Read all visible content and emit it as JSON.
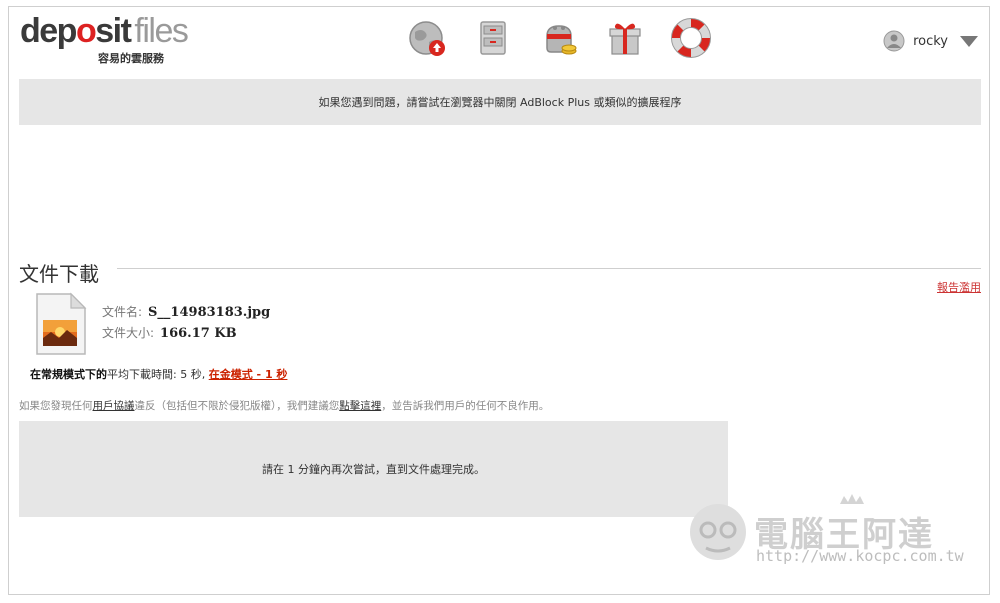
{
  "header": {
    "logo_main_a": "dep",
    "logo_main_o": "o",
    "logo_main_b": "sit",
    "logo_main_files": "files",
    "logo_tagline": "容易的雲服務",
    "nav_icons": [
      "upload-globe-icon",
      "file-cabinet-icon",
      "gold-purse-icon",
      "gift-box-icon",
      "lifebuoy-icon"
    ],
    "username": "rocky"
  },
  "banner": {
    "text": "如果您遇到問題，請嘗試在瀏覽器中關閉 AdBlock Plus 或類似的擴展程序"
  },
  "file_section": {
    "title": "文件下載",
    "report_link": "報告濫用",
    "filename_label": "文件名:",
    "filename_value": "S__14983183.jpg",
    "filesize_label": "文件大小:",
    "filesize_value": "166.17 KB"
  },
  "speed": {
    "normal_mode": "在常規模式下的",
    "avg_time_label": "平均下載時間:",
    "normal_time": "5 秒,",
    "gold_mode": "在金模式 - 1 秒"
  },
  "terms": {
    "prefix": "如果您發現任何",
    "user_agreement": "用戶協議",
    "middle": "違反（包括但不限於侵犯版權），我們建議您",
    "click_here": "點擊這裡",
    "suffix": "，並告訴我們用戶的任何不良作用。"
  },
  "wait_box": {
    "text": "請在 1 分鐘內再次嘗試，直到文件處理完成。"
  },
  "watermark": {
    "title": "電腦王阿達",
    "url": "http://www.kocpc.com.tw"
  },
  "colors": {
    "accent_red": "#cc3333",
    "banner_gray": "#e6e6e6"
  }
}
